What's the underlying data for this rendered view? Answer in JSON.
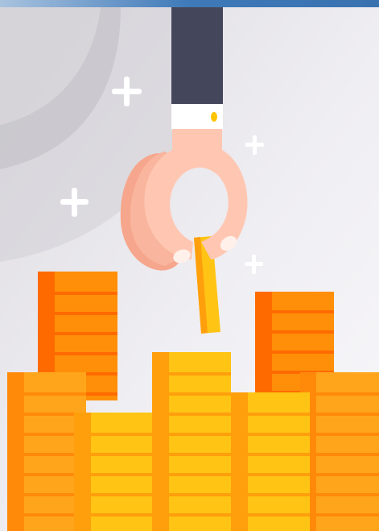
{
  "colors": {
    "background_light": "#f7f6f9",
    "background_mid": "#e6e4ea",
    "background_arc": "#c9c7cc",
    "top_bar": "#3e79b8",
    "sleeve": "#44475c",
    "cuff": "#ffffff",
    "cufflink": "#ffc400",
    "skin": "#ffc7b2",
    "skin_shadow": "#f6a68c",
    "fingernail": "#fff0ea",
    "coin_orange_face": "#ff8f08",
    "coin_orange_side": "#ff6a00",
    "coin_orange_line": "#ff6a00",
    "coin_amber_face": "#ffa51c",
    "coin_amber_side": "#ff8a0a",
    "coin_yellow_face": "#ffc414",
    "coin_yellow_side": "#ff9f0c",
    "sparkle": "#ffffff"
  },
  "icons": [
    "sparkle-plus-icon",
    "hand-icon",
    "gold-bar-icon",
    "coin-stack-icon"
  ]
}
